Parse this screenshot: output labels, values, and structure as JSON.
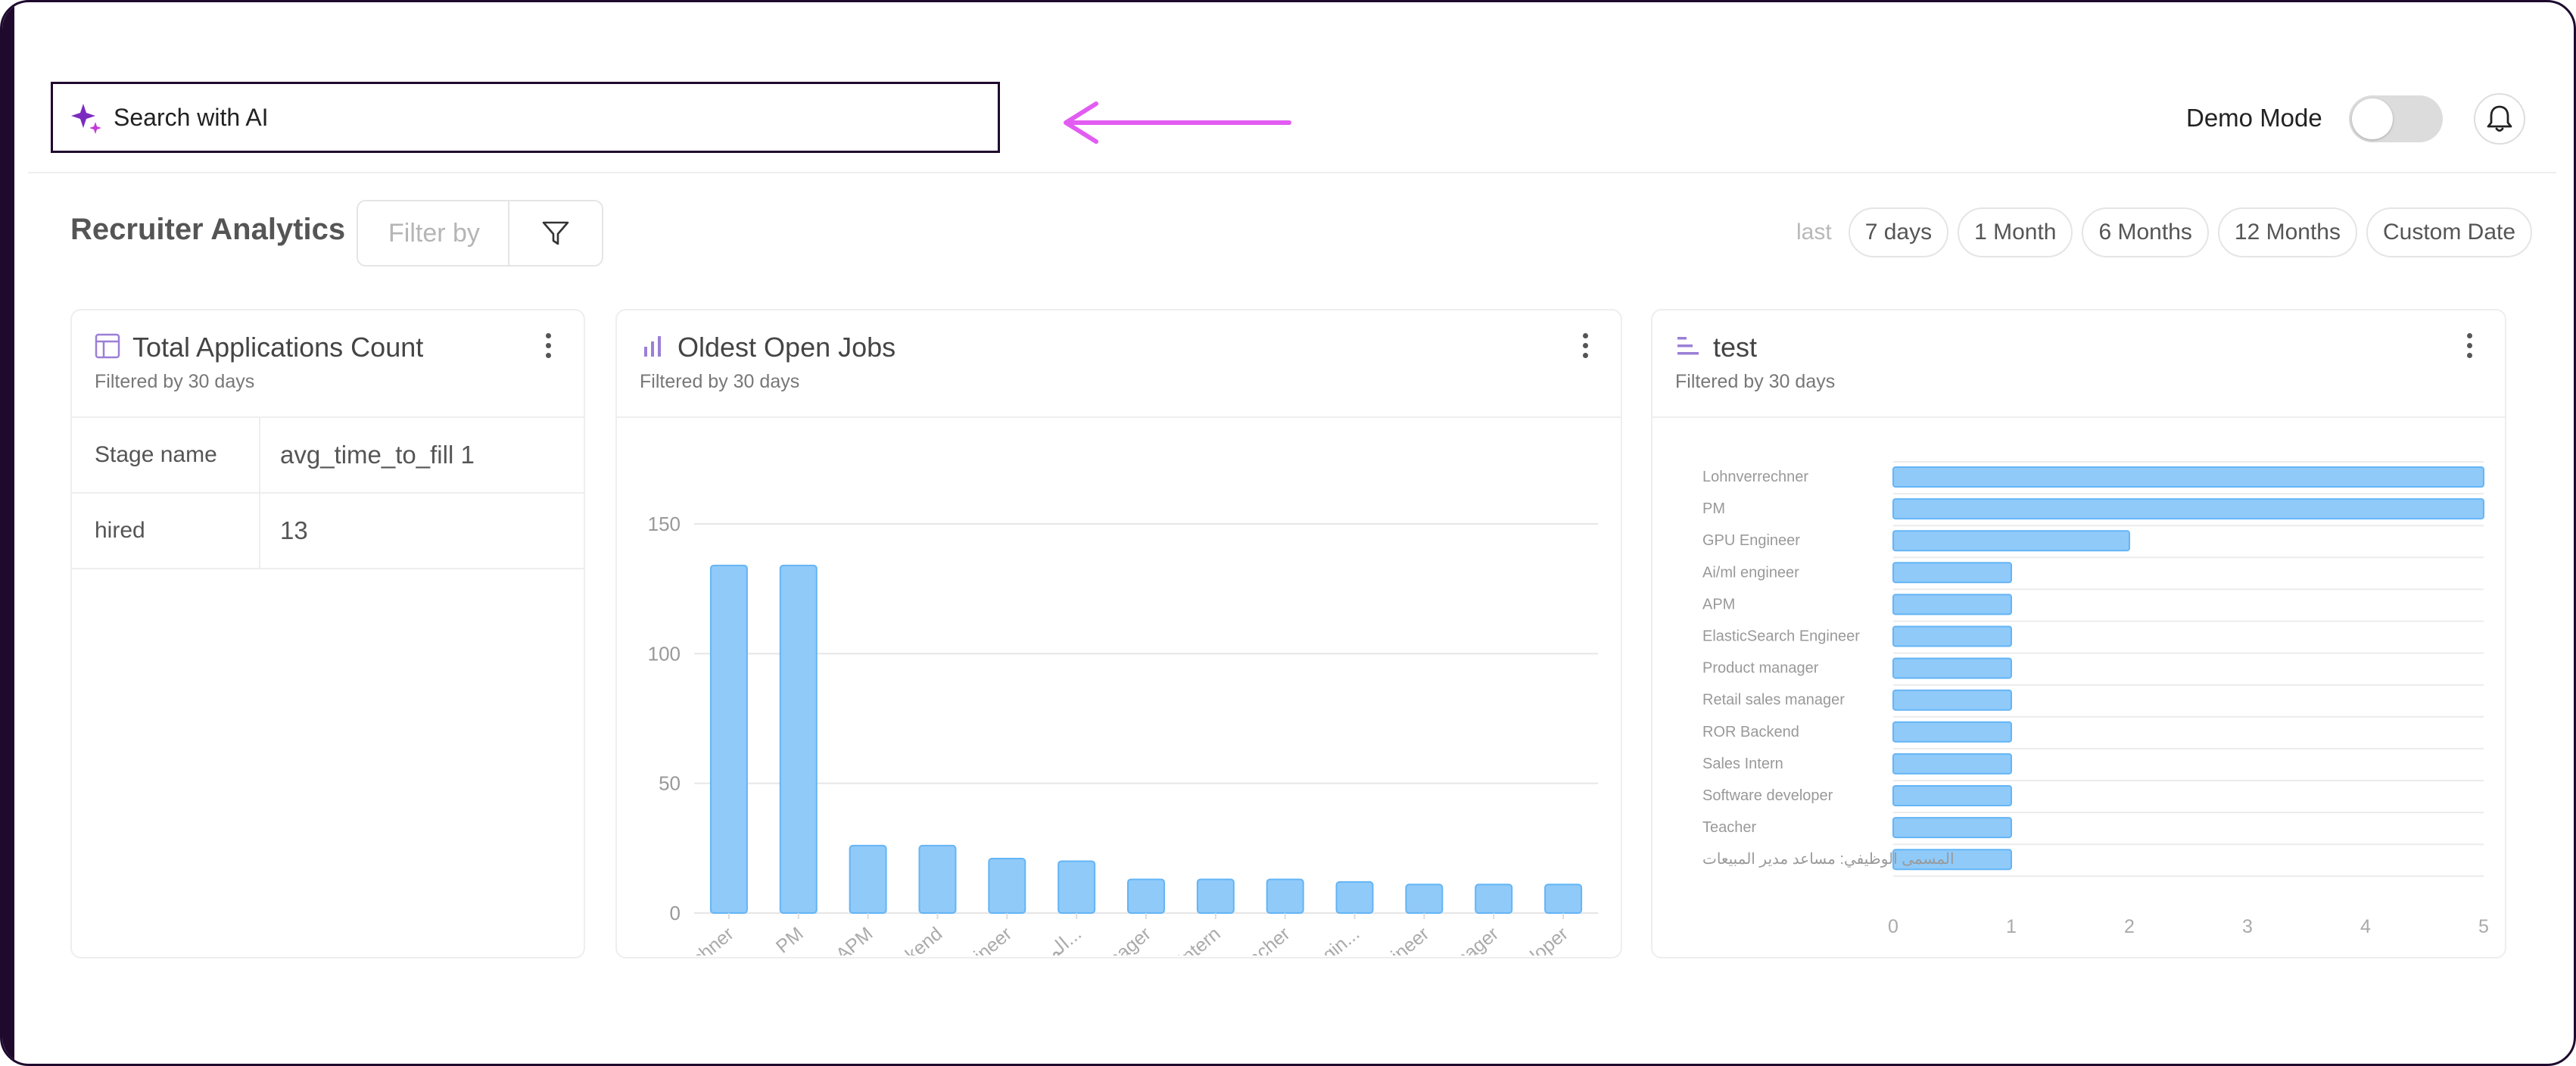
{
  "search": {
    "placeholder": "Search with AI"
  },
  "header": {
    "demo_mode_label": "Demo Mode",
    "demo_mode_on": false
  },
  "page": {
    "title": "Recruiter Analytics",
    "filter_placeholder": "Filter by",
    "range_prefix": "last",
    "ranges": [
      "7 days",
      "1 Month",
      "6 Months",
      "12 Months",
      "Custom Date"
    ]
  },
  "colors": {
    "accent": "#7b2cbf",
    "arrow": "#e25cf2",
    "bar_fill": "#90caf9",
    "bar_stroke": "#64b5f6"
  },
  "cards": {
    "applications": {
      "title": "Total Applications Count",
      "subtitle": "Filtered by 30 days",
      "rows": [
        {
          "key": "Stage name",
          "value": "avg_time_to_fill 1"
        },
        {
          "key": "hired",
          "value": "13"
        }
      ]
    },
    "oldest": {
      "title": "Oldest Open Jobs",
      "subtitle": "Filtered by 30 days"
    },
    "test": {
      "title": "test",
      "subtitle": "Filtered by 30 days"
    }
  },
  "chart_data": [
    {
      "type": "bar",
      "title": "Oldest Open Jobs",
      "categories": [
        "Lohnverrechner",
        "PM",
        "APM",
        "ROR Backend",
        "GPU Engineer",
        "المسمى الوظيفي: مساعدم...",
        "Product manager",
        "Sales Intern",
        "Teacher",
        "ElasticSearch Engin...",
        "Ai/ml engineer",
        "Retail sales manager",
        "Software developer"
      ],
      "values": [
        134,
        134,
        26,
        26,
        21,
        20,
        13,
        13,
        13,
        12,
        11,
        11,
        11
      ],
      "yticks": [
        0,
        50,
        100,
        150
      ],
      "ylim": [
        0,
        150
      ],
      "grid": true
    },
    {
      "type": "bar",
      "orientation": "horizontal",
      "title": "test",
      "categories": [
        "Lohnverrechner",
        "PM",
        "GPU Engineer",
        "Ai/ml engineer",
        "APM",
        "ElasticSearch Engineer",
        "Product manager",
        "Retail sales manager",
        "ROR Backend",
        "Sales Intern",
        "Software developer",
        "Teacher",
        "المسمى الوظيفي: مساعد مدير المبيعات"
      ],
      "values": [
        5,
        5,
        2,
        1,
        1,
        1,
        1,
        1,
        1,
        1,
        1,
        1,
        1
      ],
      "xticks": [
        0,
        1,
        2,
        3,
        4,
        5
      ],
      "xlim": [
        0,
        5
      ],
      "grid": true
    }
  ]
}
